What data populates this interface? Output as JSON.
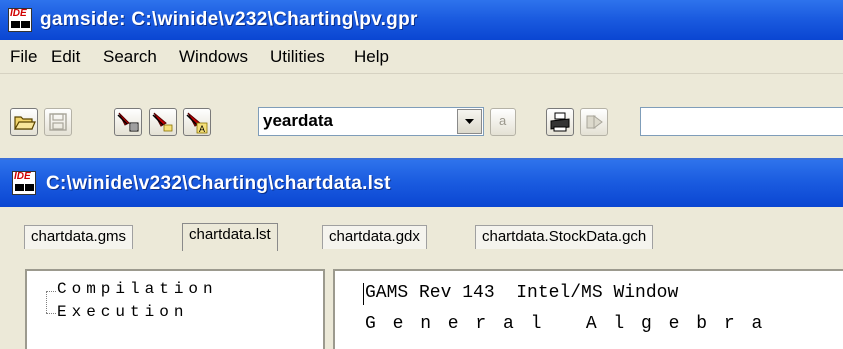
{
  "app": {
    "title": "gamside: C:\\winide\\v232\\Charting\\pv.gpr",
    "icon": "ide-icon"
  },
  "menu": [
    "File",
    "Edit",
    "Search",
    "Windows",
    "Utilities",
    "Help"
  ],
  "toolbar": {
    "buttons": [
      "open-icon",
      "save-icon",
      "compile-icon",
      "run-icon",
      "run-options-icon"
    ],
    "combo_value": "yeardata",
    "small_button": "a",
    "print_icon": "printer-icon",
    "next_icon": "arrow-right-icon",
    "search_value": ""
  },
  "child_window": {
    "title": "C:\\winide\\v232\\Charting\\chartdata.lst",
    "tabs": [
      "chartdata.gms",
      "chartdata.lst",
      "chartdata.gdx",
      "chartdata.StockData.gch"
    ],
    "active_tab_index": 1,
    "tree": [
      "Compilation",
      "Execution"
    ],
    "listing_lines": [
      "GAMS Rev 143  Intel/MS Window",
      "G e n e r a l   A l g e b r a"
    ]
  },
  "colors": {
    "titlebar": "#0A46D2",
    "chrome": "#ECE9D8"
  }
}
